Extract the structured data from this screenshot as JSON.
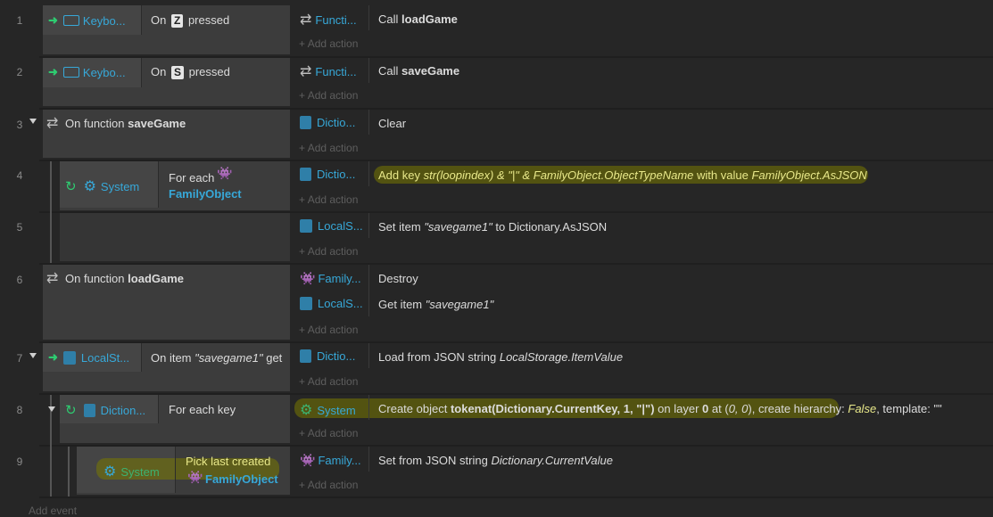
{
  "events": {
    "e1": {
      "num": "1",
      "obj": "Keybo...",
      "cond_pre": "On",
      "key": "Z",
      "cond_post": "pressed",
      "act_obj": "Functi...",
      "act_pre": "Call",
      "act_bold": "loadGame",
      "add": "Add action"
    },
    "e2": {
      "num": "2",
      "obj": "Keybo...",
      "cond_pre": "On",
      "key": "S",
      "cond_post": "pressed",
      "act_obj": "Functi...",
      "act_pre": "Call",
      "act_bold": "saveGame",
      "add": "Add action"
    },
    "e3": {
      "num": "3",
      "cond_pre": "On function",
      "cond_bold": "saveGame",
      "act_obj": "Dictio...",
      "act_text": "Clear",
      "add": "Add action"
    },
    "e4": {
      "num": "4",
      "obj": "System",
      "cond_pre": "For each",
      "cond_obj": "FamilyObject",
      "act_obj": "Dictio...",
      "act_pre": "Add key",
      "act_it1": "str(loopindex) & \"|\" & FamilyObject.ObjectTypeName",
      "act_mid": "with value",
      "act_it2": "FamilyObject.AsJSON",
      "add": "Add action"
    },
    "e5": {
      "num": "5",
      "act_obj": "LocalS...",
      "act_pre": "Set item",
      "act_it": "\"savegame1\"",
      "act_post": "to Dictionary.AsJSON",
      "add": "Add action"
    },
    "e6": {
      "num": "6",
      "cond_pre": "On function",
      "cond_bold": "loadGame",
      "act1_obj": "Family...",
      "act1_text": "Destroy",
      "act2_obj": "LocalS...",
      "act2_pre": "Get item",
      "act2_it": "\"savegame1\"",
      "add": "Add action"
    },
    "e7": {
      "num": "7",
      "obj": "LocalSt...",
      "cond_pre": "On item",
      "cond_it": "\"savegame1\"",
      "cond_post": "get",
      "act_obj": "Dictio...",
      "act_pre": "Load from JSON string",
      "act_it": "LocalStorage.ItemValue",
      "add": "Add action"
    },
    "e8": {
      "num": "8",
      "obj": "Diction...",
      "cond_text": "For each key",
      "act_obj": "System",
      "act_pre": "Create object",
      "act_bold": "tokenat(Dictionary.CurrentKey, 1, \"|\")",
      "act_mid": "on layer",
      "act_layer": "0",
      "act_at": "at (",
      "act_xy": "0, 0",
      "act_close": "), create hierarchy:",
      "act_false": "False",
      "act_tpl": ", template: \"\"",
      "add": "Add action"
    },
    "e9": {
      "num": "9",
      "obj": "System",
      "cond_pre": "Pick last created",
      "cond_obj": "FamilyObject",
      "act_obj": "Family...",
      "act_pre": "Set from JSON string",
      "act_it": "Dictionary.CurrentValue",
      "add": "Add action"
    }
  },
  "footer": {
    "add_event": "Add event"
  }
}
